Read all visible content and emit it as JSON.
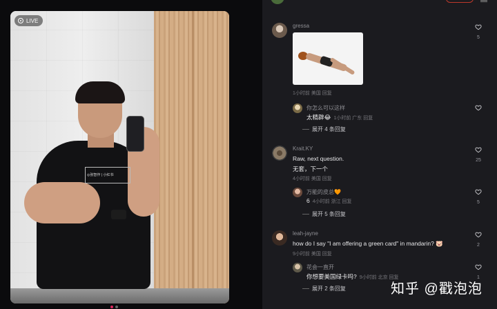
{
  "media": {
    "live_label": "LIVE",
    "shirt_print": "◎张智作 | 小红书"
  },
  "comments": [
    {
      "username": "gressa",
      "has_image": true,
      "meta": "1小时前 美国 回复",
      "likes": "5",
      "replies": [
        {
          "text": "你怎么可以这样",
          "sub": "太精辟😂",
          "meta": "1小时前 广东 回复"
        }
      ],
      "expand": "展开 4 条回复"
    },
    {
      "username": "Krait.KY",
      "text": "Raw, next question.",
      "text2": "无套，下一个",
      "meta": "4小时前 美国 回复",
      "likes": "25",
      "replies": [
        {
          "text": "万能的皮总🧡",
          "sub": "6",
          "meta": "4小时前 浙江 回复",
          "likes": "5"
        }
      ],
      "expand": "展开 5 条回复"
    },
    {
      "username": "leah-jayne",
      "text": "how do I say \"I am offering a green card\" in mandarin? 🐷",
      "meta": "9小时前 美国 回复",
      "likes": "2",
      "replies": [
        {
          "text": "花会一直开",
          "sub": "你想要美国绿卡吗?",
          "meta": "9小时前 北京 回复",
          "likes": "1"
        }
      ],
      "expand": "展开 2 条回复"
    }
  ],
  "watermark": "知乎 @戳泡泡",
  "colors": {
    "panel": "#1b1b1f",
    "accent": "#e0245e",
    "text": "#e8e8ea",
    "muted": "#77777c"
  }
}
